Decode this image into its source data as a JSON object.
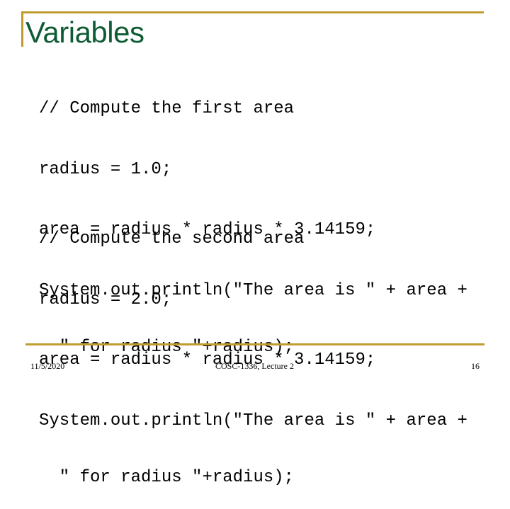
{
  "slide": {
    "title": "Variables",
    "accent_color": "#bf9b30",
    "title_color": "#0e5c34",
    "code_blocks": [
      {
        "lines": [
          "// Compute the first area",
          "radius = 1.0;",
          "area = radius * radius * 3.14159;",
          "System.out.println(\"The area is \" + area +",
          "  \" for radius \"+radius);"
        ]
      },
      {
        "lines": [
          "// Compute the second area",
          "radius = 2.0;",
          "area = radius * radius * 3.14159;",
          "System.out.println(\"The area is \" + area +",
          "  \" for radius \"+radius);"
        ]
      }
    ]
  },
  "footer": {
    "date": "11/5/2020",
    "course": "COSC-1336, Lecture 2",
    "page_number": "16"
  }
}
